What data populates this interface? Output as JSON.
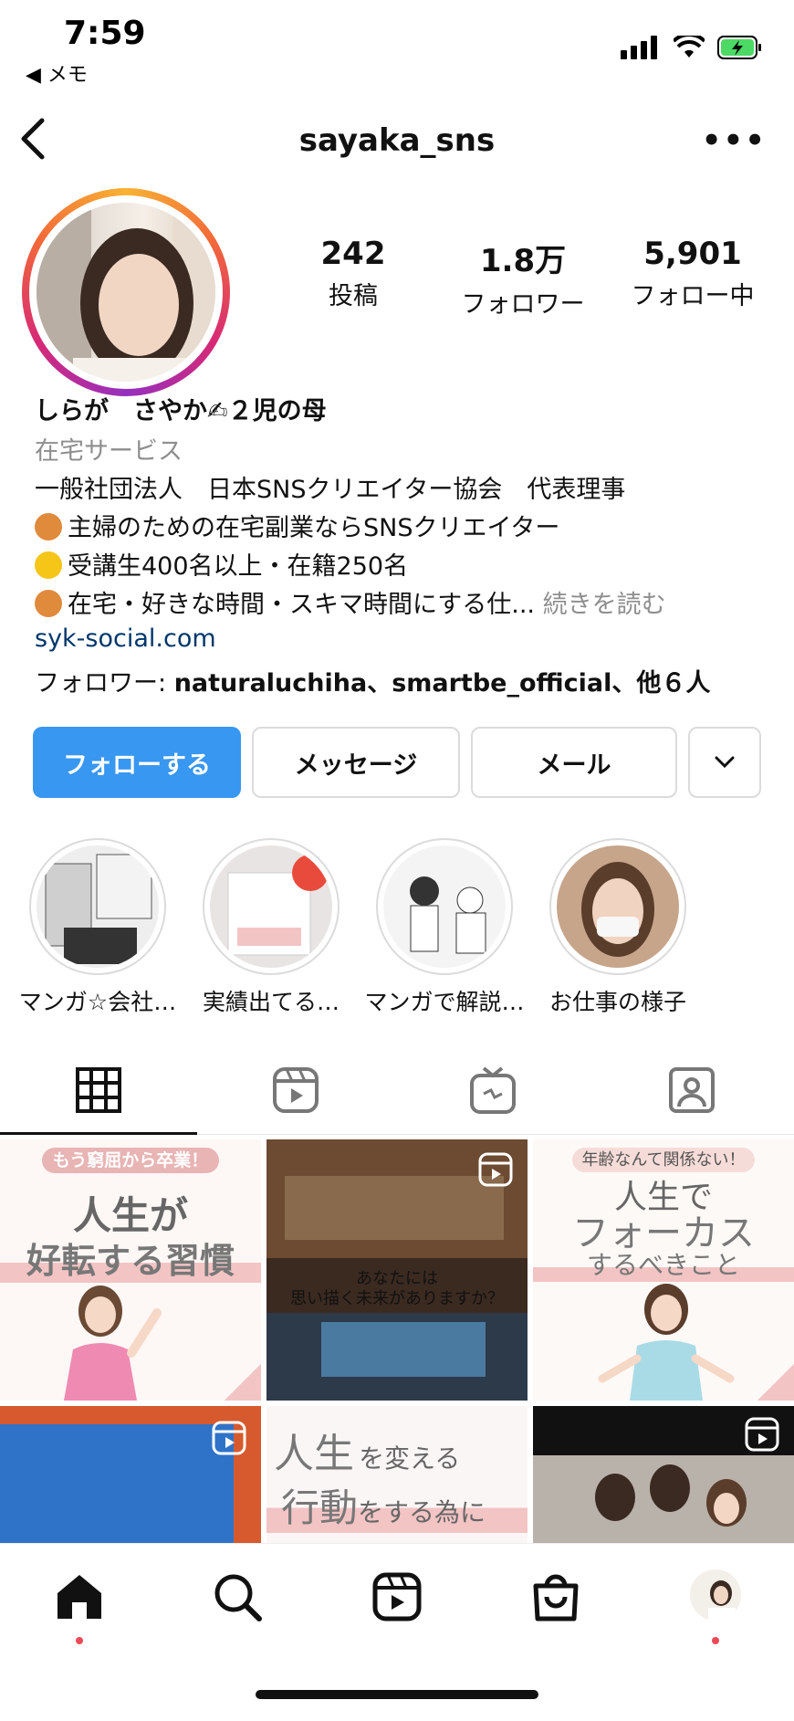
{
  "status_bar": {
    "time": "7:59",
    "back_app": "◀ メモ"
  },
  "header": {
    "username": "sayaka_sns",
    "more": "•••"
  },
  "stats": [
    {
      "value": "242",
      "label": "投稿"
    },
    {
      "value": "1.8万",
      "label": "フォロワー"
    },
    {
      "value": "5,901",
      "label": "フォロー中"
    }
  ],
  "bio": {
    "name": "しらが　さやか✍２児の母",
    "category": "在宅サービス",
    "line1": "一般社団法人　日本SNSクリエイター協会　代表理事",
    "line2": "主婦のための在宅副業ならSNSクリエイター",
    "line3": "受講生400名以上・在籍250名",
    "line4": "在宅・好きな時間・スキマ時間にする仕...",
    "more": "続きを読む",
    "link": "syk-social.com",
    "followers_prefix": "フォロワー: ",
    "followers_names": "naturaluchiha、smartbe_official、他６人",
    "dot_colors": [
      "#e08a3c",
      "#f5c518",
      "#e08a3c"
    ]
  },
  "buttons": {
    "follow": "フォローする",
    "message": "メッセージ",
    "email": "メール",
    "dropdown": "⌄"
  },
  "highlights": [
    {
      "label": "マンガ☆会社…"
    },
    {
      "label": "実績出てる…"
    },
    {
      "label": "マンガで解説…"
    },
    {
      "label": "お仕事の様子"
    }
  ],
  "tabs": [
    {
      "name": "grid-icon"
    },
    {
      "name": "reels-icon"
    },
    {
      "name": "igtv-icon"
    },
    {
      "name": "tagged-icon"
    }
  ],
  "posts": {
    "p1": {
      "banner": "もう窮屈から卒業！",
      "line1": "人生が",
      "line2": "好転する習慣"
    },
    "p2": {
      "caption1": "あなたには",
      "caption2": "思い描く未来がありますか？"
    },
    "p3": {
      "banner": "年齢なんて関係ない！",
      "line1": "人生で",
      "line2": "フォーカス",
      "line3": "するべきこと"
    },
    "p5": {
      "a": "人生",
      "b": "を変える",
      "c": "行動",
      "d": "をする為に"
    }
  },
  "colors": {
    "accent": "#3897f0",
    "link": "#00376b",
    "pink_band": "#f3c4c4"
  }
}
